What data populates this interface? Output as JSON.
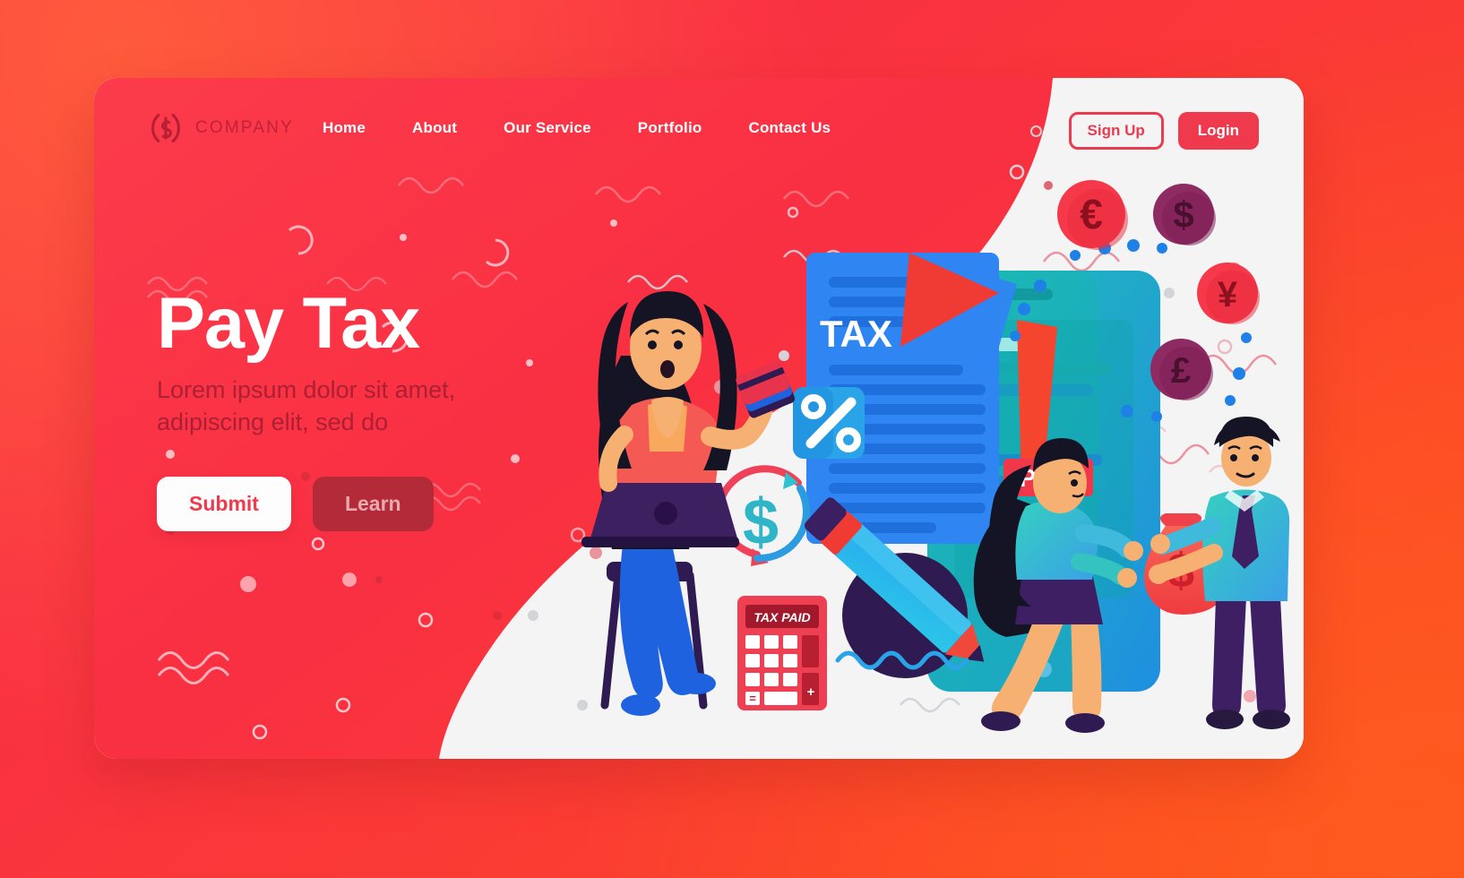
{
  "brand": {
    "logo_icon": "dollar-circle-icon",
    "name": "COMPANY",
    "accent_red": "#ed3a4d",
    "dark_red": "#b32b38",
    "text_red": "#ad1f33"
  },
  "nav": {
    "items": [
      {
        "label": "Home"
      },
      {
        "label": "About"
      },
      {
        "label": "Our Service"
      },
      {
        "label": "Portfolio"
      },
      {
        "label": "Contact Us"
      }
    ],
    "signup_label": "Sign Up",
    "login_label": "Login"
  },
  "hero": {
    "title": "Pay Tax",
    "subtitle_line1": "Lorem ipsum dolor sit amet,",
    "subtitle_line2": "adipiscing elit, sed do",
    "primary_button": "Submit",
    "secondary_button": "Learn"
  },
  "illustration": {
    "document_label": "TAX",
    "paid_badge": "PAID",
    "calculator_display": "TAX PAID",
    "calculator_plus": "+",
    "calculator_equals": "=",
    "percent_icon": "percent-badge-icon",
    "refresh_money_icon": "dollar-refresh-icon",
    "pencil_icon": "pencil-icon",
    "money_bag_symbol": "$",
    "coins": [
      {
        "name": "euro-coin",
        "symbol": "€",
        "color": "#f5394a"
      },
      {
        "name": "dollar-coin",
        "symbol": "$",
        "color": "#8e2b63"
      },
      {
        "name": "yen-coin",
        "symbol": "¥",
        "color": "#f5394a"
      },
      {
        "name": "pound-coin",
        "symbol": "£",
        "color": "#8e2b63"
      }
    ],
    "characters": [
      {
        "name": "woman-with-laptop"
      },
      {
        "name": "woman-handing-money-bag"
      },
      {
        "name": "man-receiving-money-bag"
      }
    ]
  }
}
